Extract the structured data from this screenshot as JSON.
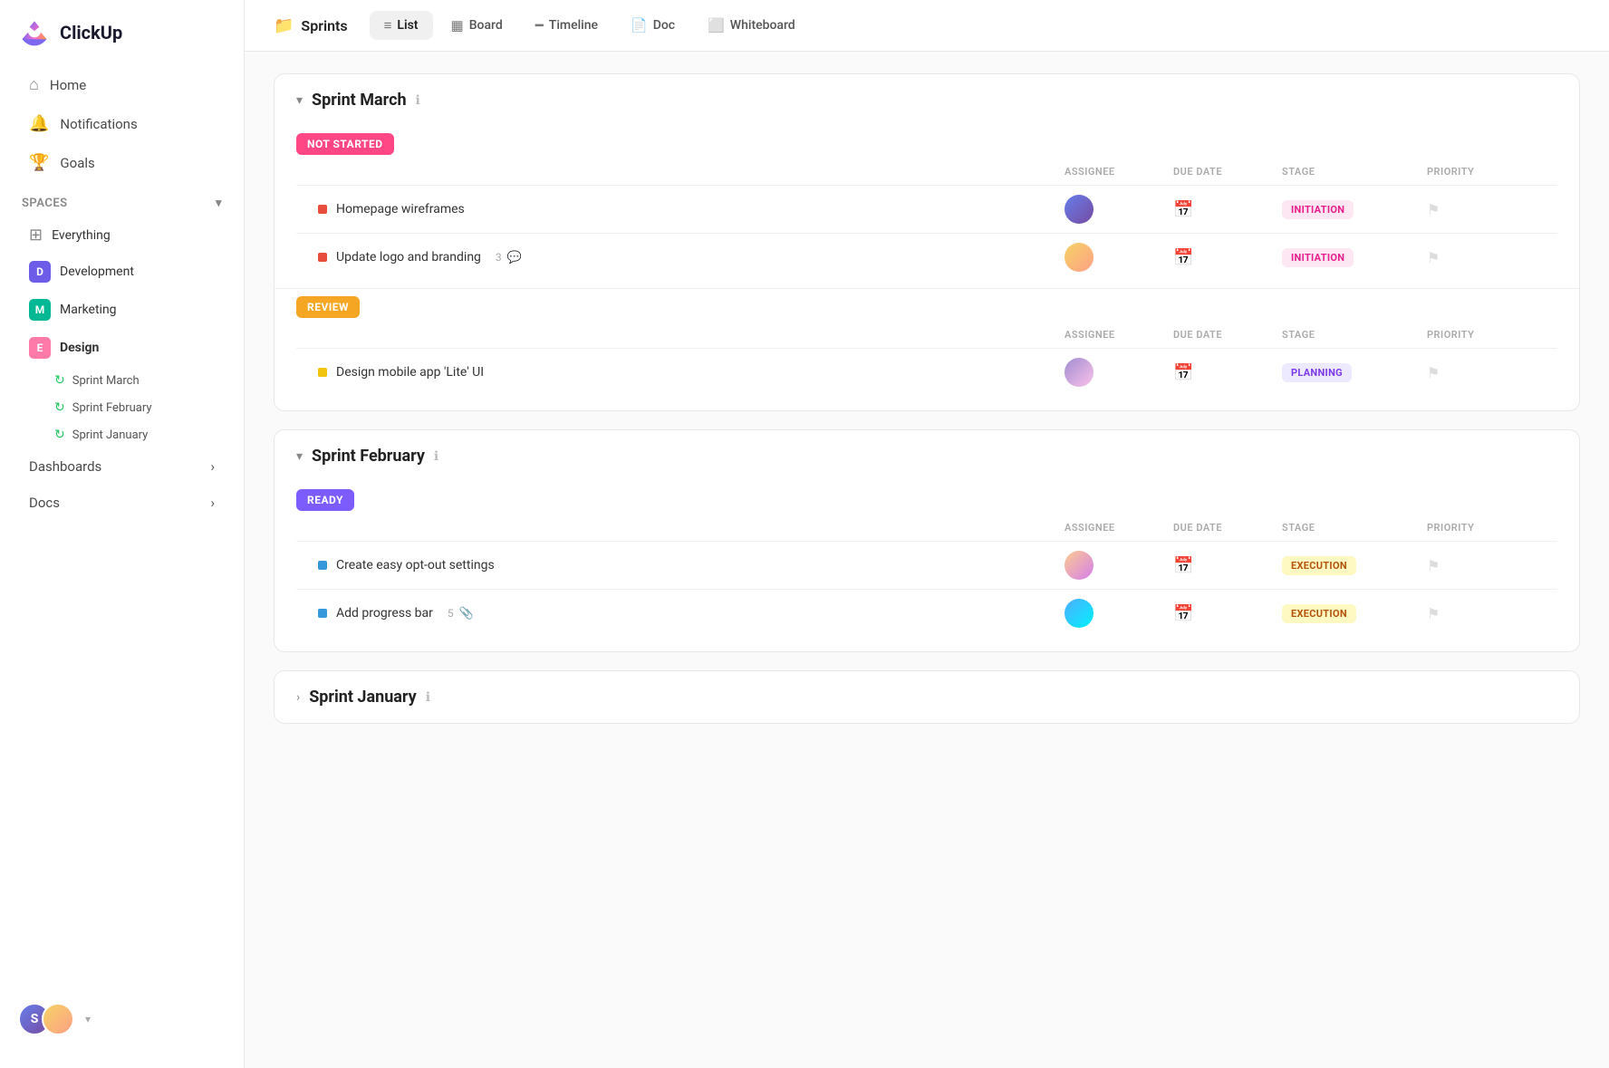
{
  "sidebar": {
    "logo": "ClickUp",
    "nav": [
      {
        "id": "home",
        "label": "Home",
        "icon": "⌂"
      },
      {
        "id": "notifications",
        "label": "Notifications",
        "icon": "🔔"
      },
      {
        "id": "goals",
        "label": "Goals",
        "icon": "🏆"
      }
    ],
    "spaces_label": "Spaces",
    "spaces": [
      {
        "id": "everything",
        "label": "Everything",
        "icon": "⊞",
        "color": null
      },
      {
        "id": "development",
        "label": "Development",
        "initial": "D",
        "color": "#6c5ce7"
      },
      {
        "id": "marketing",
        "label": "Marketing",
        "initial": "M",
        "color": "#00b894"
      },
      {
        "id": "design",
        "label": "Design",
        "initial": "E",
        "color": "#fd79a8",
        "active": true
      }
    ],
    "sprints": [
      {
        "id": "sprint-march",
        "label": "Sprint  March"
      },
      {
        "id": "sprint-february",
        "label": "Sprint  February"
      },
      {
        "id": "sprint-january",
        "label": "Sprint  January"
      }
    ],
    "dashboards_label": "Dashboards",
    "docs_label": "Docs"
  },
  "header": {
    "breadcrumb_icon": "📁",
    "breadcrumb_title": "Sprints",
    "tabs": [
      {
        "id": "list",
        "label": "List",
        "icon": "≡",
        "active": true
      },
      {
        "id": "board",
        "label": "Board",
        "icon": "▦"
      },
      {
        "id": "timeline",
        "label": "Timeline",
        "icon": "━"
      },
      {
        "id": "doc",
        "label": "Doc",
        "icon": "📄"
      },
      {
        "id": "whiteboard",
        "label": "Whiteboard",
        "icon": "⬜"
      }
    ]
  },
  "sprints": [
    {
      "id": "sprint-march",
      "title": "Sprint March",
      "expanded": true,
      "groups": [
        {
          "status": "NOT STARTED",
          "status_type": "not-started",
          "columns": [
            "ASSIGNEE",
            "DUE DATE",
            "STAGE",
            "PRIORITY"
          ],
          "tasks": [
            {
              "id": "task-1",
              "name": "Homepage wireframes",
              "dot_color": "#e74c3c",
              "stage": "INITIATION",
              "stage_type": "initiation",
              "avatar_id": "1"
            },
            {
              "id": "task-2",
              "name": "Update logo and branding",
              "dot_color": "#e74c3c",
              "comment_count": "3",
              "has_comment_icon": true,
              "stage": "INITIATION",
              "stage_type": "initiation",
              "avatar_id": "2"
            }
          ]
        },
        {
          "status": "REVIEW",
          "status_type": "review",
          "columns": [
            "ASSIGNEE",
            "DUE DATE",
            "STAGE",
            "PRIORITY"
          ],
          "tasks": [
            {
              "id": "task-3",
              "name": "Design mobile app 'Lite' UI",
              "dot_color": "#f1c40f",
              "stage": "PLANNING",
              "stage_type": "planning",
              "avatar_id": "3"
            }
          ]
        }
      ]
    },
    {
      "id": "sprint-february",
      "title": "Sprint February",
      "expanded": true,
      "groups": [
        {
          "status": "READY",
          "status_type": "ready",
          "columns": [
            "ASSIGNEE",
            "DUE DATE",
            "STAGE",
            "PRIORITY"
          ],
          "tasks": [
            {
              "id": "task-4",
              "name": "Create easy opt-out settings",
              "dot_color": "#3498db",
              "stage": "EXECUTION",
              "stage_type": "execution",
              "avatar_id": "4"
            },
            {
              "id": "task-5",
              "name": "Add progress bar",
              "dot_color": "#3498db",
              "attachment_count": "5",
              "has_attachment_icon": true,
              "stage": "EXECUTION",
              "stage_type": "execution",
              "avatar_id": "5"
            }
          ]
        }
      ]
    },
    {
      "id": "sprint-january",
      "title": "Sprint January",
      "expanded": false
    }
  ],
  "bottom_user": {
    "initials": "S"
  },
  "icons": {
    "chevron_down": "▾",
    "chevron_right": "▸",
    "info": "ℹ",
    "calendar": "📅",
    "flag": "⚑",
    "comment": "💬",
    "attachment": "📎",
    "arrow_down": "▾"
  }
}
